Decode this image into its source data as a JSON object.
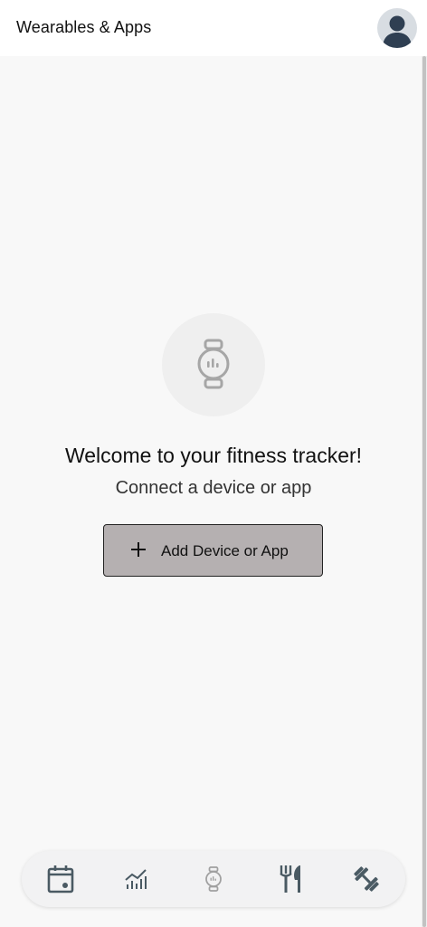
{
  "header": {
    "title": "Wearables & Apps",
    "avatar_icon": "user-avatar-icon"
  },
  "main": {
    "hero_icon": "smartwatch-icon",
    "welcome_text": "Welcome to your fitness tracker!",
    "subtitle": "Connect a device or app",
    "add_button_label": "Add Device or App",
    "add_button_icon": "plus-icon"
  },
  "bottom_nav": {
    "items": [
      {
        "icon": "calendar-icon",
        "active": false
      },
      {
        "icon": "chart-icon",
        "active": false
      },
      {
        "icon": "smartwatch-icon",
        "active": true
      },
      {
        "icon": "fork-knife-icon",
        "active": false
      },
      {
        "icon": "dumbbell-icon",
        "active": false
      }
    ]
  },
  "colors": {
    "button_bg": "#b5b0b1",
    "nav_icon": "#4a5a63",
    "nav_icon_active": "#a0a0a0",
    "avatar_fg": "#3b4a5a",
    "avatar_bg": "#d8dde2"
  }
}
